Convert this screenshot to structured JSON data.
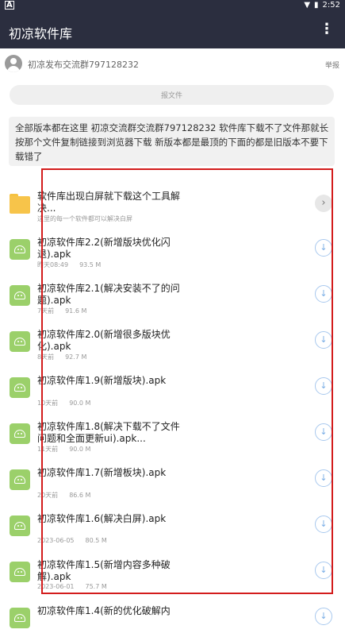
{
  "status_bar": {
    "time": "2:52",
    "left_icon": "A"
  },
  "app_bar": {
    "title": "初凉软件库",
    "menu_icon": "more-vert-icon"
  },
  "user": {
    "name": "初凉发布交流群797128232",
    "report_label": "举报"
  },
  "report_file_button": "报文件",
  "description": "全部版本都在这里 初凉交流群交流群797128232 软件库下载不了文件那就长按那个文件复制链接到浏览器下载 新版本都是最顶的下面的都是旧版本不要下载错了",
  "files": [
    {
      "type": "folder",
      "name": "软件库出现白屏就下载这个工具解决...",
      "meta_date": "这里的每一个软件都可以解决白屏",
      "meta_size": "",
      "action": "chevron-right-icon"
    },
    {
      "type": "apk",
      "name": "初凉软件库2.2(新增版块优化闪退).apk",
      "meta_date": "昨天08:49",
      "meta_size": "93.5 M",
      "action": "download-icon"
    },
    {
      "type": "apk",
      "name": "初凉软件库2.1(解决安装不了的问题).apk",
      "meta_date": "7天前",
      "meta_size": "91.6 M",
      "action": "download-icon"
    },
    {
      "type": "apk",
      "name": "初凉软件库2.0(新增很多版块优化).apk",
      "meta_date": "8天前",
      "meta_size": "92.7 M",
      "action": "download-icon"
    },
    {
      "type": "apk",
      "name": "初凉软件库1.9(新增版块).apk",
      "meta_date": "10天前",
      "meta_size": "90.0 M",
      "action": "download-icon"
    },
    {
      "type": "apk",
      "name": "初凉软件库1.8(解决下载不了文件问题和全面更新ui).apk...",
      "meta_date": "11天前",
      "meta_size": "90.0 M",
      "action": "download-icon"
    },
    {
      "type": "apk",
      "name": "初凉软件库1.7(新增板块).apk",
      "meta_date": "20天前",
      "meta_size": "86.6 M",
      "action": "download-icon"
    },
    {
      "type": "apk",
      "name": "初凉软件库1.6(解决白屏).apk",
      "meta_date": "2023-06-05",
      "meta_size": "80.5 M",
      "action": "download-icon"
    },
    {
      "type": "apk",
      "name": "初凉软件库1.5(新增内容多种破解).apk",
      "meta_date": "2023-06-01",
      "meta_size": "75.7 M",
      "action": "download-icon"
    },
    {
      "type": "apk",
      "name": "初凉软件库1.4(新的优化破解内",
      "meta_date": "",
      "meta_size": "",
      "action": "download-icon"
    }
  ],
  "colors": {
    "app_bar": "#2b2e3f",
    "highlight_border": "#d31c1c",
    "apk_icon": "#9bd06a",
    "folder_icon": "#f7c44a"
  }
}
